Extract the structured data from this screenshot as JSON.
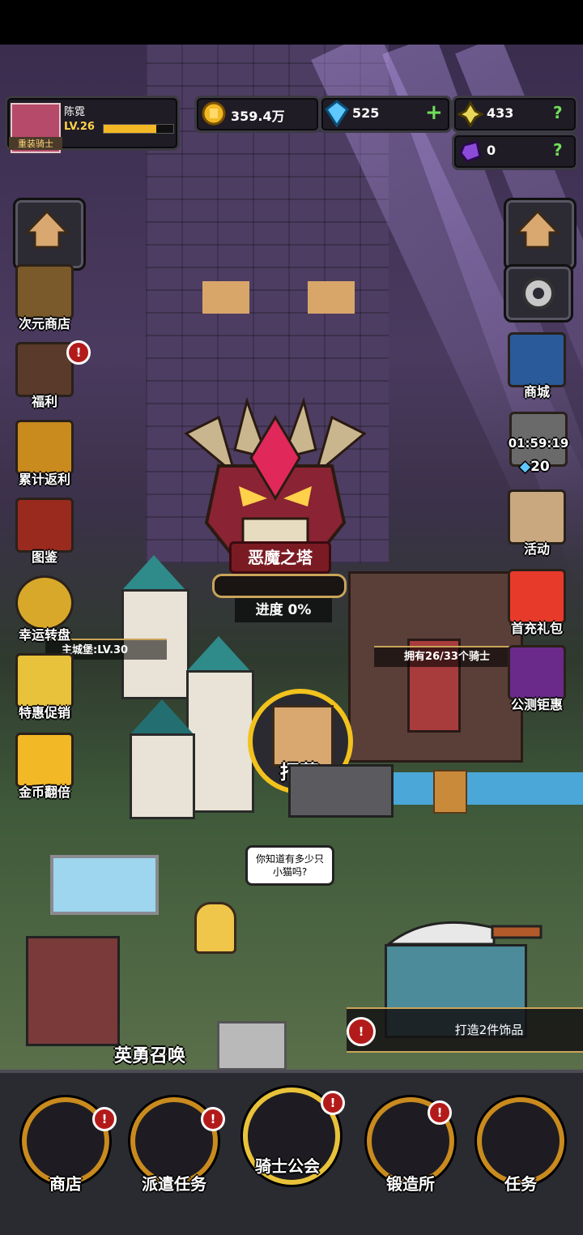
{
  "player": {
    "name": "陈霓",
    "level": "LV.26",
    "title": "重装骑士",
    "exp_fraction": 0.75
  },
  "resources": {
    "gold": "359.4万",
    "diamond": "525",
    "diamond_add": "+",
    "medal": "433",
    "medal_help": "?",
    "gem": "0",
    "gem_help": "?"
  },
  "left_menu": [
    {
      "label": "次元商店",
      "icon": "dimension-shop-icon",
      "badge": false
    },
    {
      "label": "福利",
      "icon": "welfare-chest-icon",
      "badge": true
    },
    {
      "label": "累计返利",
      "icon": "cumulative-rebate-icon",
      "badge": false
    },
    {
      "label": "图鉴",
      "icon": "codex-book-icon",
      "badge": false
    },
    {
      "label": "幸运转盘",
      "icon": "lucky-wheel-icon",
      "badge": false
    },
    {
      "label": "特惠促销",
      "icon": "special-sale-icon",
      "badge": false
    },
    {
      "label": "金币翻倍",
      "icon": "gold-double-icon",
      "badge": false
    }
  ],
  "right_menu": {
    "shop": "商城",
    "timer": "01:59:19",
    "timer_cost": "20",
    "events": "活动",
    "first_charge": "首充礼包",
    "beta_gift": "公测钜惠"
  },
  "tower": {
    "name": "恶魔之塔",
    "progress_label": "进度 0%",
    "progress": 0
  },
  "town": {
    "castle_label": "主城堡:LV.30",
    "guild_label": "拥有26/33个骑士",
    "recruit": "招募",
    "speech": "你知道有多少只小猫吗?",
    "hero_summon": "英勇召唤",
    "forge_task": "打造2件饰品",
    "alert": "!"
  },
  "bottom_nav": [
    {
      "label": "商店",
      "badge": true
    },
    {
      "label": "派遣任务",
      "badge": true
    },
    {
      "label": "骑士公会",
      "badge": true
    },
    {
      "label": "锻造所",
      "badge": true
    },
    {
      "label": "任务",
      "badge": false
    }
  ],
  "colors": {
    "gold": "#f2b826",
    "accent_red": "#b31b1b",
    "frame_orange": "#c98a1e",
    "green_plus": "#6fe05a"
  }
}
